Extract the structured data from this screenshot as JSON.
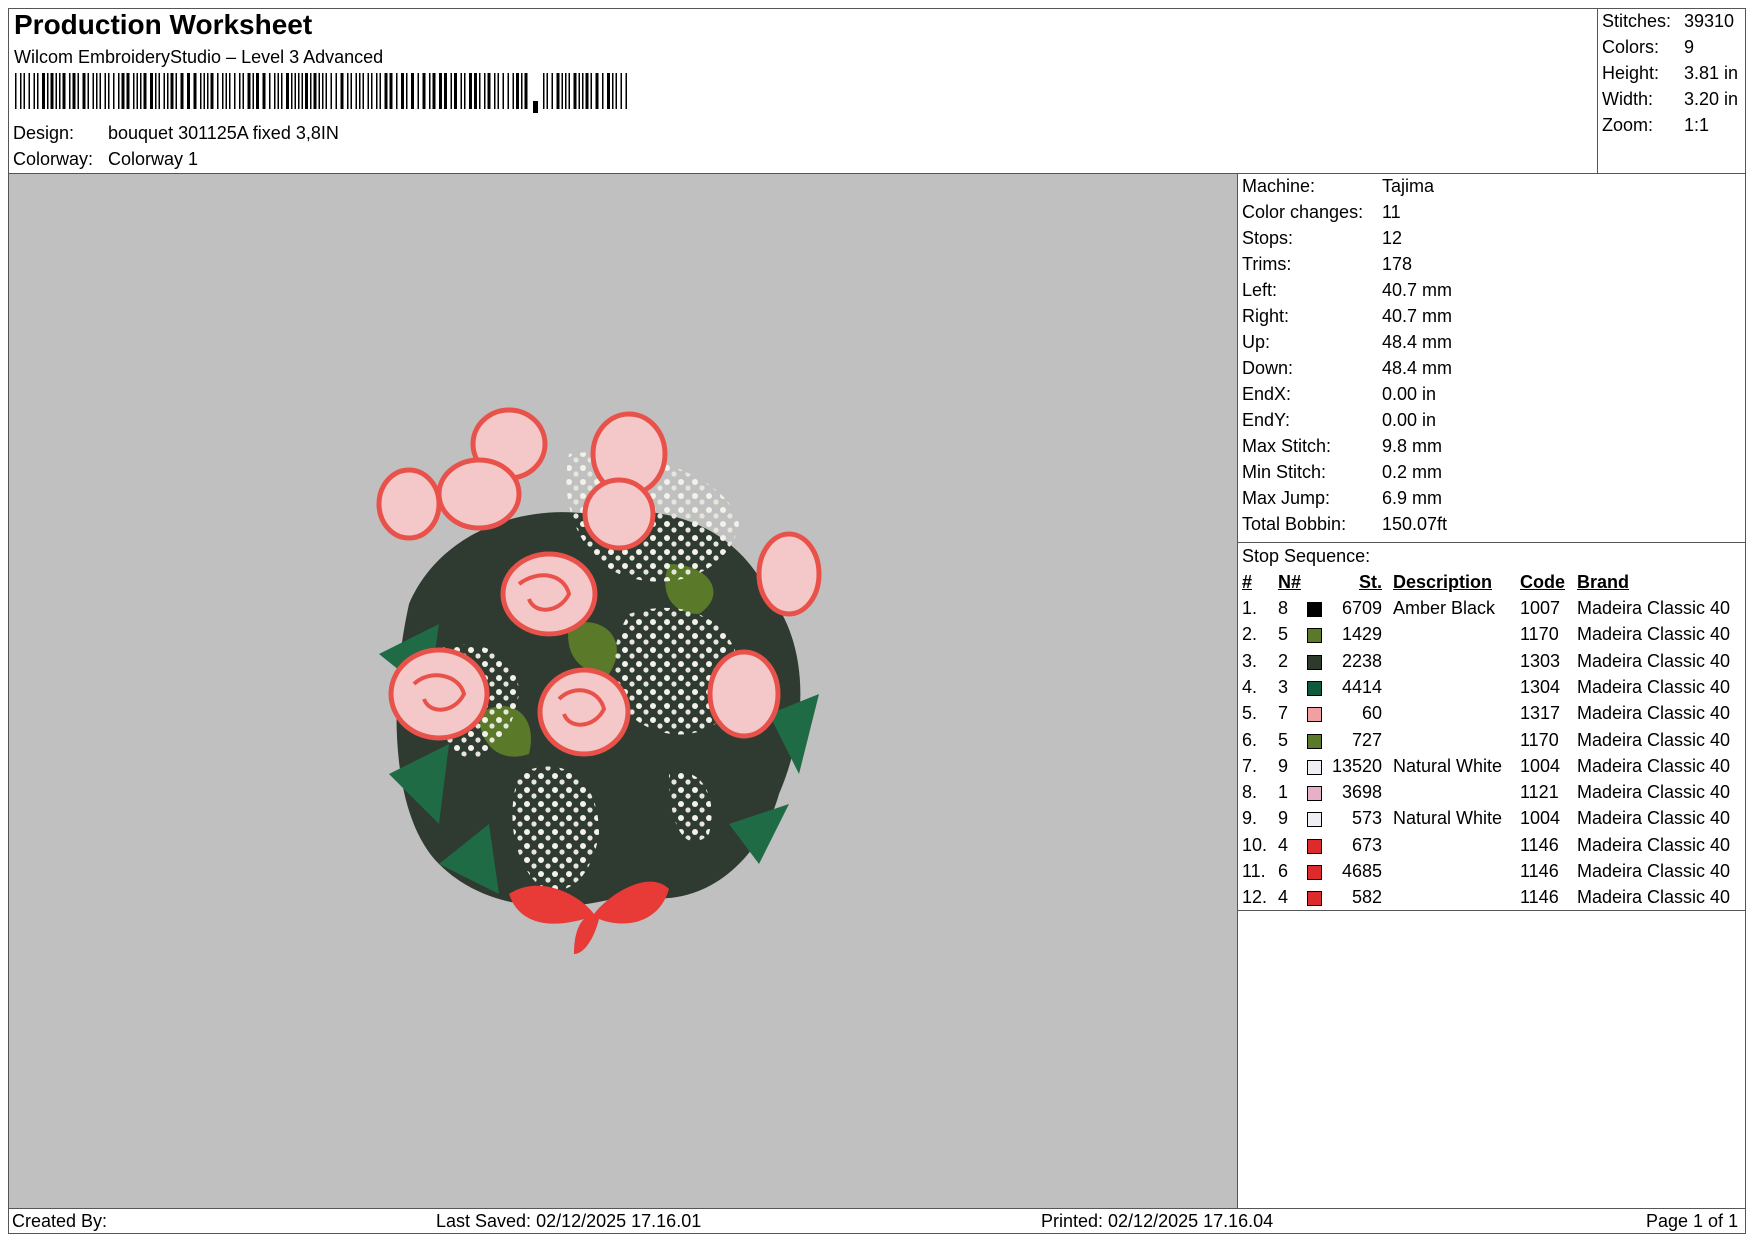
{
  "header": {
    "title": "Production Worksheet",
    "subtitle": "Wilcom EmbroideryStudio – Level 3 Advanced",
    "design_label": "Design:",
    "design_value": "bouquet 301125A fixed  3,8IN",
    "colorway_label": "Colorway:",
    "colorway_value": "Colorway 1"
  },
  "summary": [
    {
      "label": "Stitches:",
      "value": "39310"
    },
    {
      "label": "Colors:",
      "value": "9"
    },
    {
      "label": "Height:",
      "value": "3.81 in"
    },
    {
      "label": "Width:",
      "value": "3.20 in"
    },
    {
      "label": "Zoom:",
      "value": "1:1"
    }
  ],
  "machine_info": [
    {
      "label": "Machine:",
      "value": "Tajima"
    },
    {
      "label": "Color changes:",
      "value": "11"
    },
    {
      "label": "Stops:",
      "value": "12"
    },
    {
      "label": "Trims:",
      "value": "178"
    },
    {
      "label": "Left:",
      "value": "40.7 mm"
    },
    {
      "label": "Right:",
      "value": "40.7 mm"
    },
    {
      "label": "Up:",
      "value": "48.4 mm"
    },
    {
      "label": "Down:",
      "value": "48.4 mm"
    },
    {
      "label": "EndX:",
      "value": "0.00 in"
    },
    {
      "label": "EndY:",
      "value": "0.00 in"
    },
    {
      "label": "Max Stitch:",
      "value": "9.8 mm"
    },
    {
      "label": "Min Stitch:",
      "value": "0.2 mm"
    },
    {
      "label": "Max Jump:",
      "value": "6.9 mm"
    },
    {
      "label": "Total Bobbin:",
      "value": "150.07ft"
    }
  ],
  "stop_sequence": {
    "title": "Stop Sequence:",
    "headers": {
      "num": "#",
      "n": "N#",
      "st": "St.",
      "description": "Description",
      "code": "Code",
      "brand": "Brand"
    },
    "rows": [
      {
        "num": "1.",
        "n": "8",
        "color": "#000000",
        "st": "6709",
        "description": "Amber Black",
        "code": "1007",
        "brand": "Madeira Classic 40"
      },
      {
        "num": "2.",
        "n": "5",
        "color": "#5a7a2a",
        "st": "1429",
        "description": "",
        "code": "1170",
        "brand": "Madeira Classic 40"
      },
      {
        "num": "3.",
        "n": "2",
        "color": "#2e3b2c",
        "st": "2238",
        "description": "",
        "code": "1303",
        "brand": "Madeira Classic 40"
      },
      {
        "num": "4.",
        "n": "3",
        "color": "#0e5a3a",
        "st": "4414",
        "description": "",
        "code": "1304",
        "brand": "Madeira Classic 40"
      },
      {
        "num": "5.",
        "n": "7",
        "color": "#f0a0a0",
        "st": "60",
        "description": "",
        "code": "1317",
        "brand": "Madeira Classic 40"
      },
      {
        "num": "6.",
        "n": "5",
        "color": "#5a7a2a",
        "st": "727",
        "description": "",
        "code": "1170",
        "brand": "Madeira Classic 40"
      },
      {
        "num": "7.",
        "n": "9",
        "color": "#eeeef4",
        "st": "13520",
        "description": "Natural White",
        "code": "1004",
        "brand": "Madeira Classic 40"
      },
      {
        "num": "8.",
        "n": "1",
        "color": "#e8b0c8",
        "st": "3698",
        "description": "",
        "code": "1121",
        "brand": "Madeira Classic 40"
      },
      {
        "num": "9.",
        "n": "9",
        "color": "#eeeef4",
        "st": "573",
        "description": "Natural White",
        "code": "1004",
        "brand": "Madeira Classic 40"
      },
      {
        "num": "10.",
        "n": "4",
        "color": "#dd2a2a",
        "st": "673",
        "description": "",
        "code": "1146",
        "brand": "Madeira Classic 40"
      },
      {
        "num": "11.",
        "n": "6",
        "color": "#dd2a2a",
        "st": "4685",
        "description": "",
        "code": "1146",
        "brand": "Madeira Classic 40"
      },
      {
        "num": "12.",
        "n": "4",
        "color": "#dd2a2a",
        "st": "582",
        "description": "",
        "code": "1146",
        "brand": "Madeira Classic 40"
      }
    ]
  },
  "footer": {
    "created_by": "Created By:",
    "last_saved": "Last Saved: 02/12/2025 17.16.01",
    "printed": "Printed: 02/12/2025 17.16.04",
    "page": "Page 1 of 1"
  },
  "colors": {
    "preview_background": "#c0c0c0",
    "rose_red": "#e8524a",
    "leaf_green": "#1e6b45",
    "baby_breath_white": "#f2f2ea"
  }
}
